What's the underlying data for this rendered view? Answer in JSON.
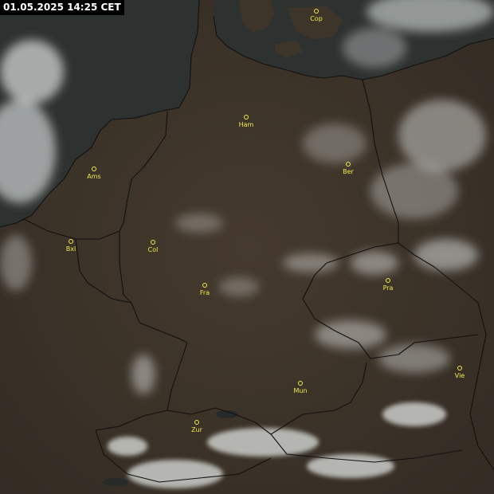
{
  "timestamp": "01.05.2025 14:25 CET",
  "colors": {
    "land": "#3b342b",
    "sea": "#2d3130",
    "cloud": "#e8ecec",
    "border": "#111111",
    "city_marker": "#f2e84a"
  },
  "cities": [
    {
      "id": "copenhagen",
      "label": "Cop"
    },
    {
      "id": "hamburg",
      "label": "Ham"
    },
    {
      "id": "berlin",
      "label": "Ber"
    },
    {
      "id": "amsterdam",
      "label": "Ams"
    },
    {
      "id": "brussels",
      "label": "Bxl"
    },
    {
      "id": "cologne",
      "label": "Col"
    },
    {
      "id": "frankfurt",
      "label": "Fra"
    },
    {
      "id": "prague",
      "label": "Pra"
    },
    {
      "id": "munich",
      "label": "Mun"
    },
    {
      "id": "vienna",
      "label": "Vie"
    },
    {
      "id": "zurich",
      "label": "Zur"
    }
  ]
}
